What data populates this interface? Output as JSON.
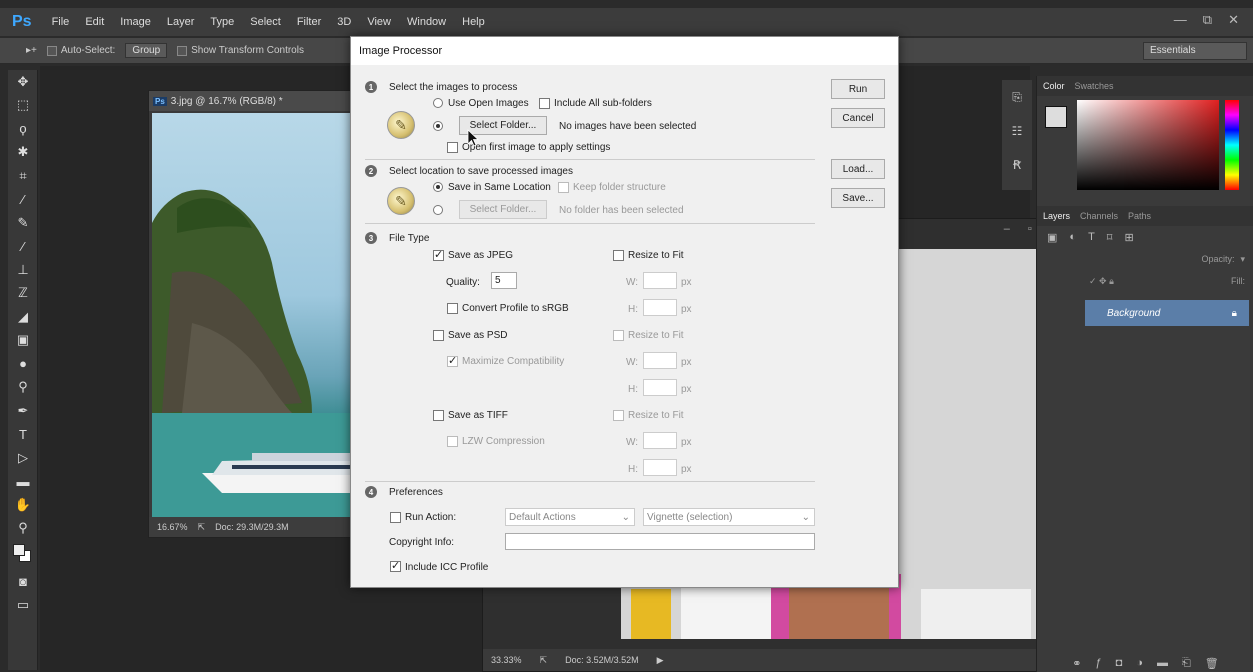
{
  "app": {
    "logo": "Ps",
    "menu": [
      "File",
      "Edit",
      "Image",
      "Layer",
      "Type",
      "Select",
      "Filter",
      "3D",
      "View",
      "Window",
      "Help"
    ],
    "window_controls": [
      "—",
      "⧉",
      "✕"
    ]
  },
  "options_bar": {
    "move_tool": "▸+",
    "auto_select_label": "Auto-Select:",
    "auto_select_value": "Group",
    "show_transform_label": "Show Transform Controls",
    "workspace": "Essentials"
  },
  "doc1": {
    "tab_title": "3.jpg @ 16.7% (RGB/8) *",
    "zoom": "16.67%",
    "doc_size": "Doc: 29.3M/29.3M"
  },
  "doc2": {
    "zoom": "33.33%",
    "doc_size": "Doc: 3.52M/3.52M"
  },
  "right_panel": {
    "color_tabs": [
      "Color",
      "Swatches"
    ],
    "layers_tabs": [
      "Layers",
      "Channels",
      "Paths"
    ],
    "opacity_label": "Opacity:",
    "fill_label": "Fill:",
    "layer_name": "Background"
  },
  "dialog": {
    "title": "Image Processor",
    "step1_title": "Select the images to process",
    "use_open_images": "Use Open Images",
    "include_subfolders": "Include All sub-folders",
    "select_folder_btn": "Select Folder...",
    "no_images": "No images have been selected",
    "open_first_image": "Open first image to apply settings",
    "step2_title": "Select location to save processed images",
    "save_same_location": "Save in Same Location",
    "keep_folder_structure": "Keep folder structure",
    "select_folder_btn2": "Select Folder...",
    "no_folder": "No folder has been selected",
    "step3_title": "File Type",
    "save_jpeg": "Save as JPEG",
    "resize_fit_1": "Resize to Fit",
    "quality_label": "Quality:",
    "quality_value": "5",
    "w_label": "W:",
    "h_label": "H:",
    "px": "px",
    "convert_srgb": "Convert Profile to sRGB",
    "save_psd": "Save as PSD",
    "resize_fit_2": "Resize to Fit",
    "maximize_compat": "Maximize Compatibility",
    "save_tiff": "Save as TIFF",
    "resize_fit_3": "Resize to Fit",
    "lzw": "LZW Compression",
    "step4_title": "Preferences",
    "run_action": "Run Action:",
    "action_set": "Default Actions",
    "action_name": "Vignette (selection)",
    "copyright_label": "Copyright Info:",
    "include_icc": "Include ICC Profile",
    "buttons": {
      "run": "Run",
      "cancel": "Cancel",
      "load": "Load...",
      "save": "Save..."
    }
  }
}
